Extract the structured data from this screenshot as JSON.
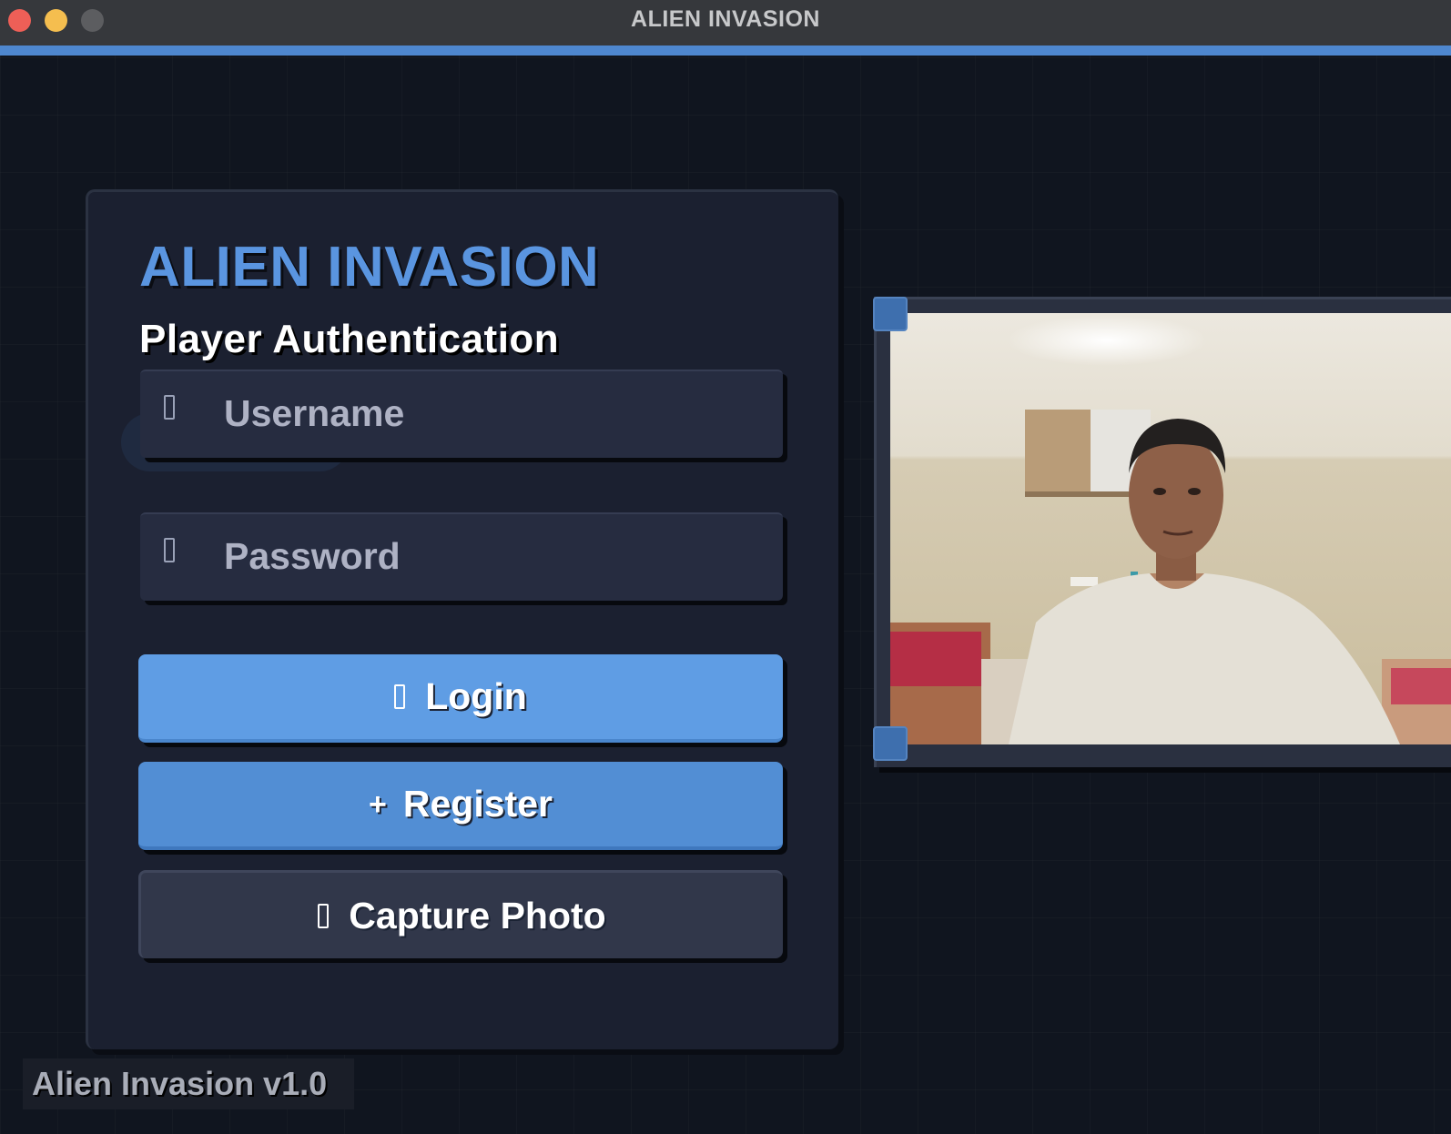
{
  "window": {
    "title": "ALIEN INVASION"
  },
  "auth": {
    "title": "ALIEN INVASION",
    "subtitle": "Player Authentication",
    "username": {
      "placeholder": "Username",
      "value": "",
      "icon": "user-icon"
    },
    "password": {
      "placeholder": "Password",
      "value": "",
      "icon": "lock-icon"
    },
    "buttons": {
      "login": {
        "label": "Login",
        "icon": "login-icon"
      },
      "register": {
        "label": "Register",
        "icon": "plus-icon"
      },
      "capture": {
        "label": "Capture Photo",
        "icon": "camera-icon"
      }
    }
  },
  "camera": {
    "description": "Live webcam preview"
  },
  "footer": {
    "version": "Alien Invasion v1.0"
  },
  "colors": {
    "accent": "#4e87cf",
    "title": "#5a95e0",
    "login_button": "#5f9de4",
    "register_button": "#528ed4",
    "capture_button": "#31374a",
    "panel": "#1b2030",
    "background": "#10151f"
  }
}
